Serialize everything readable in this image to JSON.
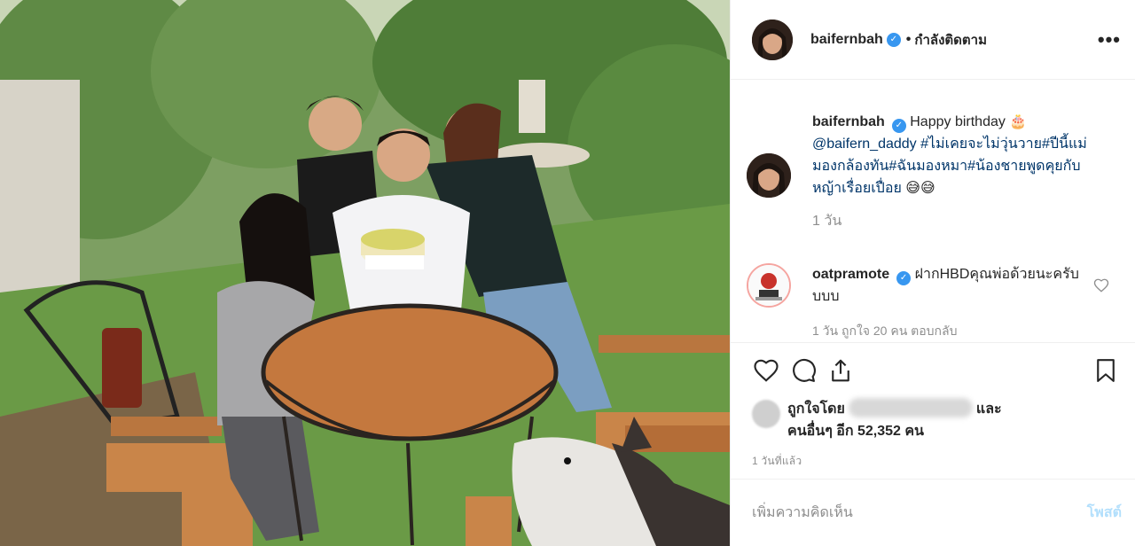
{
  "post": {
    "username": "baifernbah",
    "follow_status": "กำลังติดตาม",
    "more_label": "•••"
  },
  "caption": {
    "username": "baifernbah",
    "text_start": "Happy birthday",
    "emoji_cake": "🎂",
    "mention": "@baifern_daddy",
    "hashtag1": "#ไม่เคยจะไม่วุ่นวาย",
    "hashtag2": "#ปีนี้แม่มองกล้องทัน",
    "hashtag3": "#ฉันมองหมา",
    "hashtag4": "#น้องชายพูดคุยกับหญ้าเรื่อยเปื่อย",
    "emoji_end": "😅😅",
    "time": "1 วัน"
  },
  "comment": {
    "username": "oatpramote",
    "text": "ฝากHBDคุณพ่อด้วยนะครับบบบ",
    "meta": "1 วัน   ถูกใจ 20 คน   ตอบกลับ"
  },
  "likes": {
    "prefix": "ถูกใจโดย",
    "and": "และ",
    "others": "คนอื่นๆ อีก 52,352 คน"
  },
  "posted_ago": "1 วันที่แล้ว",
  "add_comment": {
    "placeholder": "เพิ่มความคิดเห็น",
    "post_label": "โพสต์"
  },
  "colors": {
    "link": "#003569",
    "verified": "#3897f0",
    "secondary_text": "#8e8e8e",
    "post_disabled": "#b2dffc"
  }
}
